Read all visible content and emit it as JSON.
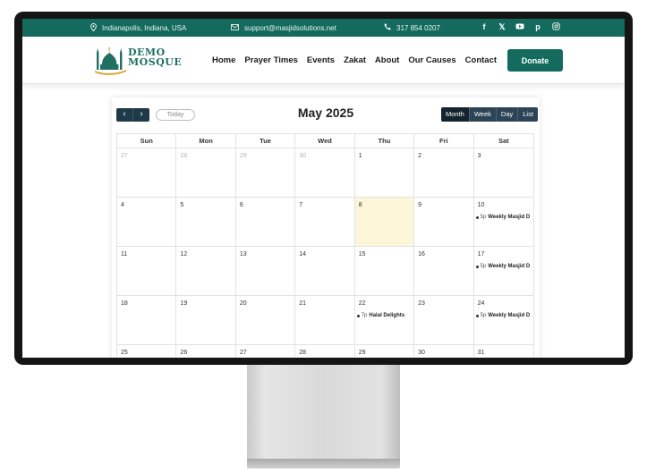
{
  "topbar": {
    "location": "Indianapolis, Indiana, USA",
    "email": "support@masjidsolutions.net",
    "phone": "317 854 0207",
    "icons": [
      "facebook-icon",
      "x-twitter-icon",
      "youtube-icon",
      "pinterest-icon",
      "instagram-icon"
    ]
  },
  "brand": {
    "line1": "DEMO",
    "line2": "MOSQUE"
  },
  "nav": [
    "Home",
    "Prayer Times",
    "Events",
    "Zakat",
    "About",
    "Our Causes",
    "Contact"
  ],
  "donate_label": "Donate",
  "calendar": {
    "title": "May 2025",
    "today_label": "Today",
    "prev": "‹",
    "next": "›",
    "views": [
      "Month",
      "Week",
      "Day",
      "List"
    ],
    "active_view": "Month",
    "days_of_week": [
      "Sun",
      "Mon",
      "Tue",
      "Wed",
      "Thu",
      "Fri",
      "Sat"
    ],
    "today_date": "8",
    "weeks": [
      [
        {
          "n": "27",
          "other": true
        },
        {
          "n": "28",
          "other": true
        },
        {
          "n": "29",
          "other": true
        },
        {
          "n": "30",
          "other": true
        },
        {
          "n": "1"
        },
        {
          "n": "2"
        },
        {
          "n": "3"
        }
      ],
      [
        {
          "n": "4"
        },
        {
          "n": "5"
        },
        {
          "n": "6"
        },
        {
          "n": "7"
        },
        {
          "n": "8",
          "today": true
        },
        {
          "n": "9"
        },
        {
          "n": "10",
          "event": {
            "time": "5p",
            "title": "Weekly Masjid D"
          }
        }
      ],
      [
        {
          "n": "11"
        },
        {
          "n": "12"
        },
        {
          "n": "13"
        },
        {
          "n": "14"
        },
        {
          "n": "15"
        },
        {
          "n": "16"
        },
        {
          "n": "17",
          "event": {
            "time": "5p",
            "title": "Weekly Masjid D"
          }
        }
      ],
      [
        {
          "n": "18"
        },
        {
          "n": "19"
        },
        {
          "n": "20"
        },
        {
          "n": "21"
        },
        {
          "n": "22",
          "event": {
            "time": "7p",
            "title": "Halal Delights"
          }
        },
        {
          "n": "23"
        },
        {
          "n": "24",
          "event": {
            "time": "5p",
            "title": "Weekly Masjid D"
          }
        }
      ],
      [
        {
          "n": "25"
        },
        {
          "n": "26"
        },
        {
          "n": "27"
        },
        {
          "n": "28"
        },
        {
          "n": "29"
        },
        {
          "n": "30"
        },
        {
          "n": "31"
        }
      ]
    ]
  },
  "colors": {
    "primary": "#146b5d",
    "navy": "#1e3a48",
    "today_bg": "#fdf6d8",
    "gold": "#d9a53a"
  }
}
